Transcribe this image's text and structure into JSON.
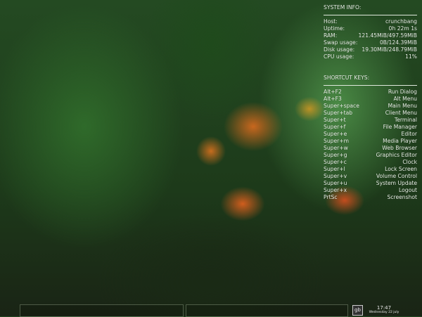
{
  "system_info": {
    "title": "SYSTEM INFO:",
    "rows": [
      {
        "label": "Host:",
        "value": "crunchbang"
      },
      {
        "label": "Uptime:",
        "value": "0h 22m 1s"
      },
      {
        "label": "RAM:",
        "value": "121.45MiB/497.59MiB"
      },
      {
        "label": "Swap usage:",
        "value": "0B/124.39MiB"
      },
      {
        "label": "Disk usage:",
        "value": "19.30MiB/248.79MiB"
      },
      {
        "label": "CPU usage:",
        "value": "11%"
      }
    ]
  },
  "shortcuts": {
    "title": "SHORTCUT KEYS:",
    "rows": [
      {
        "key": "Alt+F2",
        "action": "Run Dialog"
      },
      {
        "key": "Alt+F3",
        "action": "Alt Menu"
      },
      {
        "key": "Super+space",
        "action": "Main Menu"
      },
      {
        "key": "Super+tab",
        "action": "Client Menu"
      },
      {
        "key": "Super+t",
        "action": "Terminal"
      },
      {
        "key": "Super+f",
        "action": "File Manager"
      },
      {
        "key": "Super+e",
        "action": "Editor"
      },
      {
        "key": "Super+m",
        "action": "Media Player"
      },
      {
        "key": "Super+w",
        "action": "Web Browser"
      },
      {
        "key": "Super+g",
        "action": "Graphics Editor"
      },
      {
        "key": "Super+c",
        "action": "Clock"
      },
      {
        "key": "Super+l",
        "action": "Lock Screen"
      },
      {
        "key": "Super+v",
        "action": "Volume Control"
      },
      {
        "key": "Super+u",
        "action": "System Update"
      },
      {
        "key": "Super+x",
        "action": "Logout"
      },
      {
        "key": "PrtSc",
        "action": "Screenshot"
      }
    ]
  },
  "panel": {
    "keyboard_layout": "gb",
    "time": "17:47",
    "date": "Wednesday 22 july"
  }
}
